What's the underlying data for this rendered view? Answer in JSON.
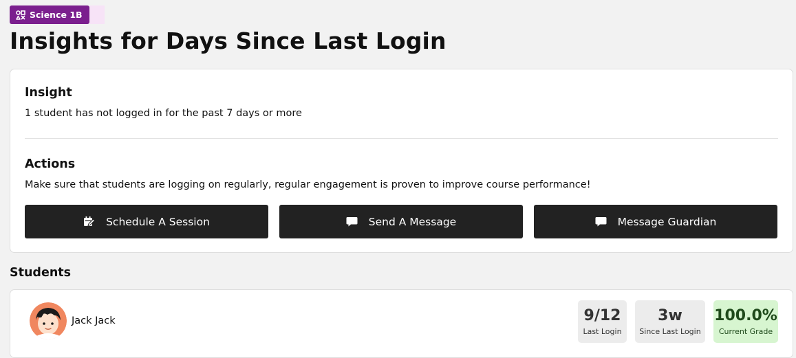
{
  "course": {
    "label": "Science 1B",
    "icon": "course-icon",
    "color": "#7b1f8e",
    "tint": "#f7e3f7"
  },
  "page": {
    "title": "Insights for Days Since Last Login"
  },
  "insight": {
    "title": "Insight",
    "text": "1 student has not logged in for the past 7 days or more"
  },
  "actions": {
    "title": "Actions",
    "text": "Make sure that students are logging on regularly, regular engagement is proven to improve course performance!",
    "buttons": [
      {
        "label": "Schedule A Session",
        "icon": "calendar-edit-icon"
      },
      {
        "label": "Send A Message",
        "icon": "message-icon"
      },
      {
        "label": "Message Guardian",
        "icon": "message-icon"
      }
    ]
  },
  "students": {
    "title": "Students",
    "items": [
      {
        "name": "Jack Jack",
        "avatar": "avatar-icon",
        "stats": [
          {
            "value": "9/12",
            "label": "Last Login"
          },
          {
            "value": "3w",
            "label": "Since Last Login"
          },
          {
            "value": "100.0%",
            "label": "Current Grade",
            "color": "#d7f5d0"
          }
        ]
      }
    ]
  }
}
